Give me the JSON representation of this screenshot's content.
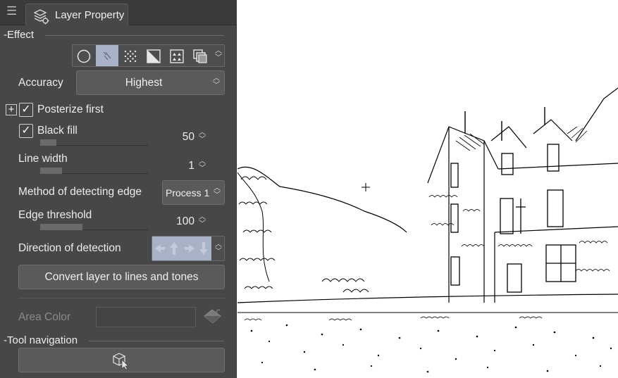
{
  "window": {
    "tab_title": "Layer Property",
    "menu_icon": "hamburger-menu-icon",
    "tab_icon": "layer-property-icon"
  },
  "effect": {
    "header": "Effect",
    "buttons": [
      {
        "name": "border-effect",
        "icon": "circle-outline-icon",
        "selected": false
      },
      {
        "name": "extract-line",
        "icon": "extract-line-icon",
        "selected": true
      },
      {
        "name": "tone",
        "icon": "halftone-dots-icon",
        "selected": false
      },
      {
        "name": "layer-color",
        "icon": "gradient-icon",
        "selected": false
      },
      {
        "name": "tone-pattern",
        "icon": "triangle-pattern-icon",
        "selected": false
      },
      {
        "name": "mask-color",
        "icon": "layer-stack-icon",
        "selected": false
      }
    ]
  },
  "accuracy": {
    "label": "Accuracy",
    "value": "Highest"
  },
  "posterize": {
    "label": "Posterize first",
    "checked": true
  },
  "black_fill": {
    "label": "Black fill",
    "checked": true,
    "value": "50",
    "level": 0.15
  },
  "line_width": {
    "label": "Line width",
    "value": "1",
    "level": 0.2
  },
  "edge_method": {
    "label": "Method of detecting edge",
    "value": "Process 1"
  },
  "edge_threshold": {
    "label": "Edge threshold",
    "value": "100",
    "level": 0.39
  },
  "direction": {
    "label": "Direction of detection",
    "icon": "direction-arrows-icon"
  },
  "convert_button": "Convert layer to lines and tones",
  "area_color": {
    "label": "Area Color",
    "icon": "paint-bucket-icon"
  },
  "tool_navigation": {
    "header": "Tool navigation",
    "icon": "3d-cursor-icon"
  },
  "colors": {
    "panel_bg": "#474747",
    "selected_bg": "#a9b3c8",
    "canvas_bg": "#ffffff"
  }
}
